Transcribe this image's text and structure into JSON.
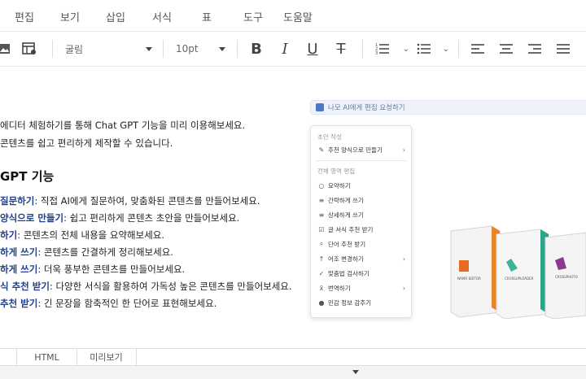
{
  "menu_bar": [
    "편집",
    "보기",
    "삽입",
    "서식",
    "표",
    "도구",
    "도움말"
  ],
  "toolbar": {
    "font_name": "굴림",
    "font_size": "10pt",
    "bold_label": "B",
    "italic_label": "I",
    "underline_label": "U",
    "strike_label": "T"
  },
  "document": {
    "line1": "에디터 체험하기를 통해 Chat GPT 기능을 미리 이용해보세요.",
    "line2": "콘텐츠를 쉽고 편리하게 제작할 수 있습니다.",
    "heading": "GPT 기능",
    "bullets": [
      {
        "bold": "질문하기",
        "rest": ": 직접 AI에게 질문하여, 맞춤화된 콘텐츠를 만들어보세요."
      },
      {
        "bold": "양식으로 만들기",
        "rest": ": 쉽고 편리하게 콘텐츠 초안을 만들어보세요."
      },
      {
        "bold": "하기",
        "rest": ": 콘텐츠의 전체 내용을 요약해보세요."
      },
      {
        "bold": "하게 쓰기",
        "rest": ": 콘텐츠를 간결하게 정리해보세요."
      },
      {
        "bold": "하게 쓰기",
        "rest": ": 더욱 풍부한 콘텐츠를 만들어보세요."
      },
      {
        "bold": "식 추천 받기",
        "rest": ": 다양한 서식을 활용하여 가독성 높은 콘텐츠를 만들어보세요."
      },
      {
        "bold": "추천 받기",
        "rest": ": 긴 문장을 함축적인 한 단어로 표현해보세요."
      }
    ]
  },
  "ai_bar": {
    "placeholder": "나모 AI에게 편집 요청하기"
  },
  "ai_menu": {
    "section1": "초안 작성",
    "item_template": "추천 양식으로 만들기",
    "section2": "전체 영역 편집",
    "items": [
      {
        "label": "요약하기",
        "icon": "chat-icon",
        "glyph": "○"
      },
      {
        "label": "간략하게 쓰기",
        "icon": "lines-icon",
        "glyph": "≡"
      },
      {
        "label": "상세하게 쓰기",
        "icon": "lines-icon",
        "glyph": "≡"
      },
      {
        "label": "글 서식 추천 받기",
        "icon": "check-box-icon",
        "glyph": "☑"
      },
      {
        "label": "단어 추천 받기",
        "icon": "search-icon",
        "glyph": "⌕"
      },
      {
        "label": "어조 변경하기",
        "icon": "arrow-up-icon",
        "glyph": "↑",
        "submenu": true
      },
      {
        "label": "맞춤법 검사하기",
        "icon": "check-icon",
        "glyph": "✓"
      },
      {
        "label": "번역하기",
        "icon": "translate-icon",
        "glyph": "x̄",
        "submenu": true
      },
      {
        "label": "민감 정보 감추기",
        "icon": "privacy-icon",
        "glyph": "●"
      }
    ]
  },
  "products": {
    "box1_name": "NAMO EDITOR",
    "box2_name": "CROSSUPLOADER",
    "box3_name": "CROSSPHOTO"
  },
  "tabs": [
    "HTML",
    "미리보기"
  ],
  "colors": {
    "accent": "#1f3f8f",
    "ai_blue": "#4a78c9"
  }
}
